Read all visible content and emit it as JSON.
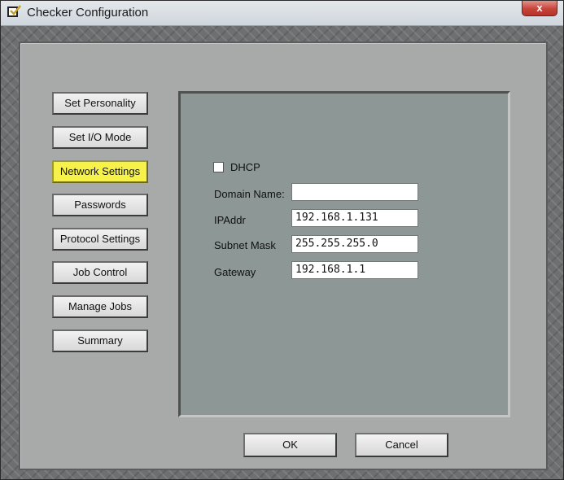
{
  "window": {
    "title": "Checker Configuration",
    "close_label": "x"
  },
  "nav": {
    "items": [
      {
        "label": "Set Personality",
        "active": false
      },
      {
        "label": "Set I/O Mode",
        "active": false
      },
      {
        "label": "Network Settings",
        "active": true
      },
      {
        "label": "Passwords",
        "active": false
      },
      {
        "label": "Protocol Settings",
        "active": false
      },
      {
        "label": "Job Control",
        "active": false
      },
      {
        "label": "Manage Jobs",
        "active": false
      },
      {
        "label": "Summary",
        "active": false
      }
    ],
    "active_color": "#f7f24a"
  },
  "network": {
    "dhcp_label": "DHCP",
    "dhcp_checked": false,
    "domain_label": "Domain Name:",
    "domain_value": "",
    "ip_label": "IPAddr",
    "ip_value": "192.168.1.131",
    "subnet_label": "Subnet Mask",
    "subnet_value": "255.255.255.0",
    "gateway_label": "Gateway",
    "gateway_value": "192.168.1.1"
  },
  "buttons": {
    "ok_label": "OK",
    "cancel_label": "Cancel"
  }
}
